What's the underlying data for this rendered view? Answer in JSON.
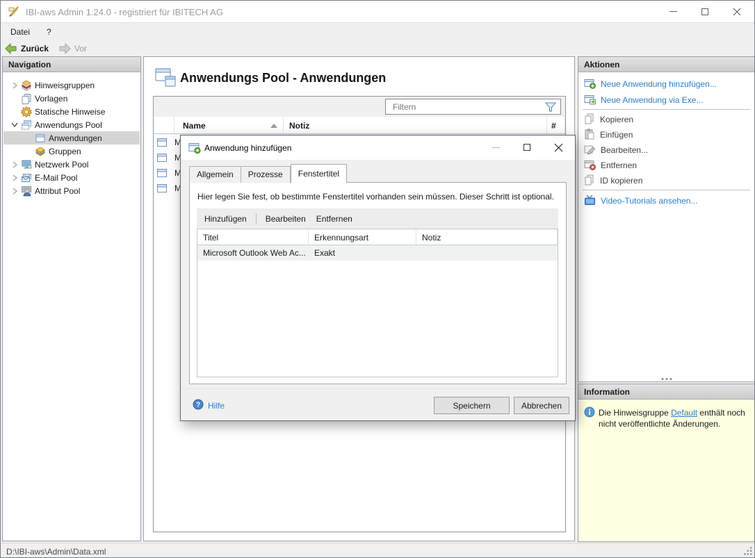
{
  "window": {
    "title": "IBI-aws Admin 1.24.0 - registriert für IBITECH AG"
  },
  "menubar": {
    "items": [
      {
        "label": "Datei"
      },
      {
        "label": "?"
      }
    ]
  },
  "toolbar": {
    "back_label": "Zurück",
    "forward_label": "Vor"
  },
  "navigation": {
    "header": "Navigation",
    "items": [
      {
        "label": "Hinweisgruppen",
        "icon": "notice-groups",
        "expander": "collapsed",
        "level": 0,
        "selected": false
      },
      {
        "label": "Vorlagen",
        "icon": "templates",
        "expander": "none",
        "level": 0,
        "selected": false
      },
      {
        "label": "Statische Hinweise",
        "icon": "static-notices",
        "expander": "none",
        "level": 0,
        "selected": false
      },
      {
        "label": "Anwendungs Pool",
        "icon": "application-pool",
        "expander": "expanded",
        "level": 0,
        "selected": false
      },
      {
        "label": "Anwendungen",
        "icon": "application",
        "expander": "none",
        "level": 1,
        "selected": true
      },
      {
        "label": "Gruppen",
        "icon": "groups",
        "expander": "none",
        "level": 1,
        "selected": false
      },
      {
        "label": "Netzwerk Pool",
        "icon": "network-pool",
        "expander": "collapsed",
        "level": 0,
        "selected": false
      },
      {
        "label": "E-Mail Pool",
        "icon": "email-pool",
        "expander": "collapsed",
        "level": 0,
        "selected": false
      },
      {
        "label": "Attribut Pool",
        "icon": "attribute-pool",
        "expander": "collapsed",
        "level": 0,
        "selected": false
      }
    ]
  },
  "main": {
    "title": "Anwendungs Pool - Anwendungen",
    "filter": {
      "placeholder": "Filtern"
    },
    "table": {
      "columns": [
        "Name",
        "Notiz",
        "#"
      ],
      "sort_column": "Name",
      "sort_direction": "ascending",
      "rows": [
        {
          "name": "M"
        },
        {
          "name": "M"
        },
        {
          "name": "M"
        },
        {
          "name": "M"
        }
      ]
    }
  },
  "dialog": {
    "title": "Anwendung hinzufügen",
    "tabs": [
      {
        "label": "Allgemein",
        "active": false
      },
      {
        "label": "Prozesse",
        "active": false
      },
      {
        "label": "Fenstertitel",
        "active": true
      }
    ],
    "description": "Hier legen Sie fest, ob bestimmte Fenstertitel vorhanden sein müssen. Dieser Schritt ist optional.",
    "toolbar": {
      "add_label": "Hinzufügen",
      "edit_label": "Bearbeiten",
      "remove_label": "Entfernen"
    },
    "table": {
      "columns": [
        "Titel",
        "Erkennungsart",
        "Notiz"
      ],
      "rows": [
        {
          "titel": "Microsoft Outlook Web Ac...",
          "erkennungsart": "Exakt",
          "notiz": ""
        }
      ]
    },
    "help_label": "Hilfe",
    "save_label": "Speichern",
    "cancel_label": "Abbrechen"
  },
  "actions": {
    "header": "Aktionen",
    "items": [
      {
        "label": "Neue Anwendung hinzufügen...",
        "enabled": true,
        "icon": "window-add"
      },
      {
        "label": "Neue Anwendung via Exe...",
        "enabled": true,
        "icon": "window-add-exe"
      },
      {
        "label": "Kopieren",
        "enabled": false,
        "icon": "copy"
      },
      {
        "label": "Einfügen",
        "enabled": false,
        "icon": "paste"
      },
      {
        "label": "Bearbeiten...",
        "enabled": false,
        "icon": "edit"
      },
      {
        "label": "Entfernen",
        "enabled": false,
        "icon": "window-remove"
      },
      {
        "label": "ID kopieren",
        "enabled": false,
        "icon": "copy"
      },
      {
        "label": "Video-Tutorials ansehen...",
        "enabled": true,
        "icon": "tv"
      }
    ]
  },
  "information": {
    "header": "Information",
    "text_before": "Die Hinweisgruppe ",
    "link_label": "Default",
    "text_after": " enthält noch nicht veröffentlichte Änderungen."
  },
  "statusbar": {
    "path": "D:\\IBI-aws\\Admin\\Data.xml"
  },
  "colors": {
    "link_blue": "#2a7fc9",
    "info_background": "#ffffe1",
    "back_arrow_green": "#8cbf4c",
    "selected_row": "#d5d5d5"
  }
}
